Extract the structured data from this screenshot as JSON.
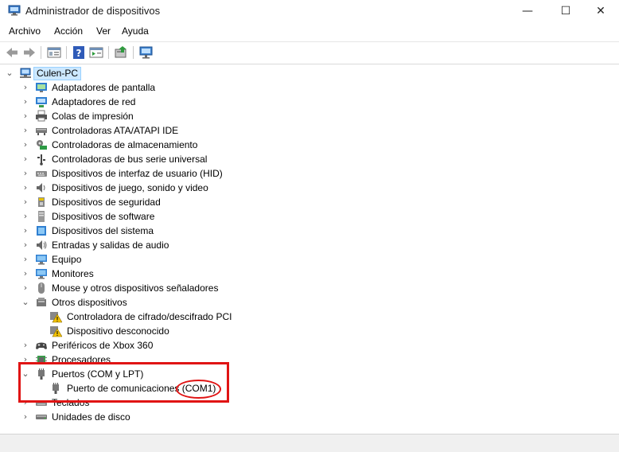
{
  "window": {
    "title": "Administrador de dispositivos"
  },
  "window_buttons": {
    "minimize": "—",
    "maximize": "☐",
    "close": "✕"
  },
  "menu": [
    "Archivo",
    "Acción",
    "Ver",
    "Ayuda"
  ],
  "toolbar": [
    "back-icon",
    "forward-icon",
    "properties-icon",
    "help-icon",
    "view-icon",
    "update-driver-icon",
    "scan-hardware-icon"
  ],
  "tree": {
    "root": "Culen-PC",
    "items": [
      {
        "label": "Adaptadores de pantalla",
        "icon": "display-adapter-icon",
        "expanded": false
      },
      {
        "label": "Adaptadores de red",
        "icon": "network-adapter-icon",
        "expanded": false
      },
      {
        "label": "Colas de impresión",
        "icon": "printer-icon",
        "expanded": false
      },
      {
        "label": "Controladoras ATA/ATAPI IDE",
        "icon": "ide-controller-icon",
        "expanded": false
      },
      {
        "label": "Controladoras de almacenamiento",
        "icon": "storage-controller-icon",
        "expanded": false
      },
      {
        "label": "Controladoras de bus serie universal",
        "icon": "usb-icon",
        "expanded": false
      },
      {
        "label": "Dispositivos de interfaz de usuario (HID)",
        "icon": "hid-icon",
        "expanded": false
      },
      {
        "label": "Dispositivos de juego, sonido y video",
        "icon": "speaker-icon",
        "expanded": false
      },
      {
        "label": "Dispositivos de seguridad",
        "icon": "security-device-icon",
        "expanded": false
      },
      {
        "label": "Dispositivos de software",
        "icon": "software-device-icon",
        "expanded": false
      },
      {
        "label": "Dispositivos del sistema",
        "icon": "system-device-icon",
        "expanded": false
      },
      {
        "label": "Entradas y salidas de audio",
        "icon": "audio-io-icon",
        "expanded": false
      },
      {
        "label": "Equipo",
        "icon": "computer-icon",
        "expanded": false
      },
      {
        "label": "Monitores",
        "icon": "monitor-icon",
        "expanded": false
      },
      {
        "label": "Mouse y otros dispositivos señaladores",
        "icon": "mouse-icon",
        "expanded": false
      },
      {
        "label": "Otros dispositivos",
        "icon": "other-devices-icon",
        "expanded": true,
        "children": [
          {
            "label": "Controladora de cifrado/descifrado PCI",
            "icon": "warning-device-icon"
          },
          {
            "label": "Dispositivo desconocido",
            "icon": "warning-device-icon"
          }
        ]
      },
      {
        "label": "Periféricos de Xbox 360",
        "icon": "gamepad-icon",
        "expanded": false
      },
      {
        "label": "Procesadores",
        "icon": "processor-icon",
        "expanded": false
      },
      {
        "label": "Puertos (COM y LPT)",
        "icon": "port-icon",
        "expanded": true,
        "children": [
          {
            "label": "Puerto de comunicaciones (COM1)",
            "icon": "port-icon"
          }
        ]
      },
      {
        "label": "Teclados",
        "icon": "keyboard-icon",
        "expanded": false
      },
      {
        "label": "Unidades de disco",
        "icon": "disk-drive-icon",
        "expanded": false
      }
    ]
  },
  "colors": {
    "selection": "#cce8ff",
    "annotation": "#e01414"
  }
}
